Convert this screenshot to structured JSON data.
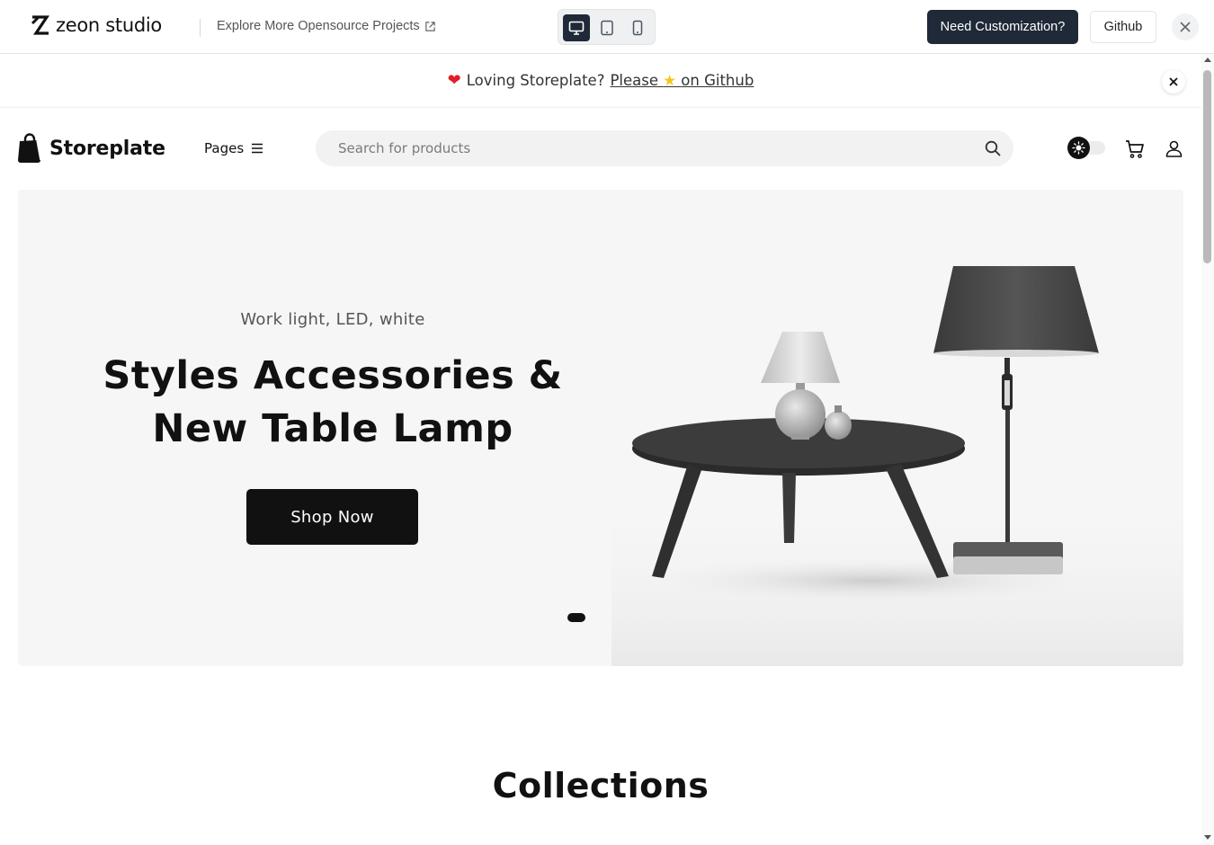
{
  "topbar": {
    "brand": "zeon studio",
    "explore_link": "Explore More Opensource Projects",
    "devices": [
      "desktop-icon",
      "tablet-icon",
      "mobile-icon"
    ],
    "active_device": "desktop",
    "customize_button": "Need Customization?",
    "github_button": "Github"
  },
  "announcement": {
    "prefix": "Loving Storeplate?",
    "link_part1": "Please",
    "link_part2": "on Github",
    "icons": [
      "heart-icon",
      "star-icon"
    ]
  },
  "header": {
    "brand": "Storeplate",
    "pages_label": "Pages",
    "search_placeholder": "Search for products"
  },
  "hero": {
    "subtitle": "Work light, LED, white",
    "title": "Styles Accessories & New Table Lamp",
    "cta": "Shop Now",
    "slides_total": 1,
    "active_slide": 1
  },
  "collections": {
    "title": "Collections"
  },
  "colors": {
    "primary_dark": "#111111",
    "toolbar_dark": "#1f2937",
    "hero_bg": "#f6f6f6",
    "heart": "#e11d2b",
    "star": "#f5c518"
  }
}
